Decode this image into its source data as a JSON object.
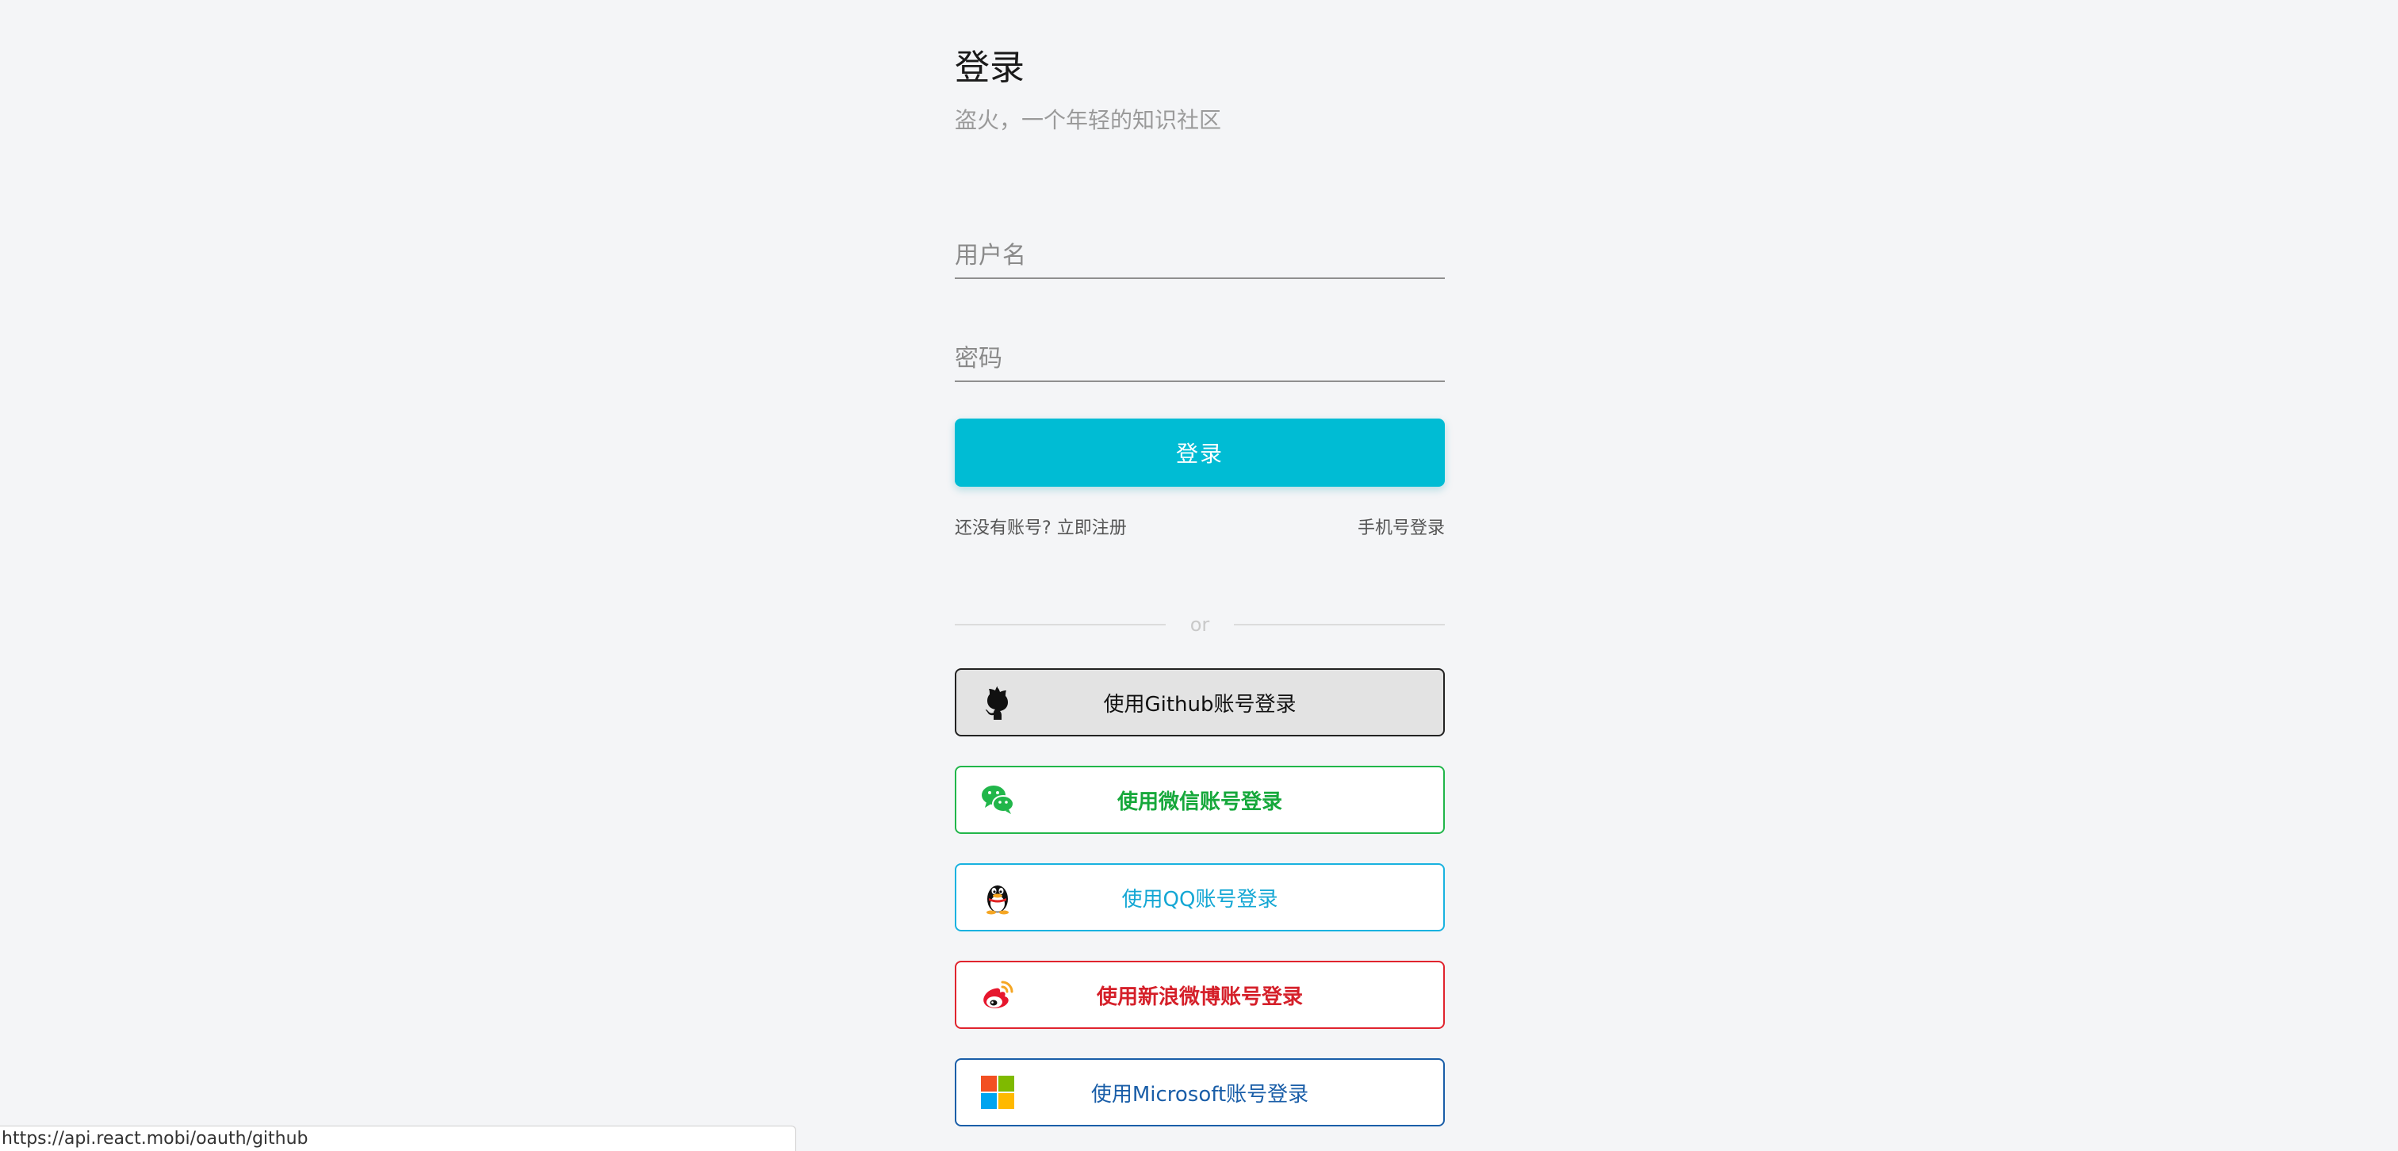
{
  "header": {
    "title": "登录",
    "subtitle": "盗火，一个年轻的知识社区"
  },
  "form": {
    "username_placeholder": "用户名",
    "password_placeholder": "密码",
    "submit_label": "登录"
  },
  "links": {
    "no_account": "还没有账号?",
    "register": "立即注册",
    "phone_login": "手机号登录"
  },
  "divider": {
    "text": "or"
  },
  "social": {
    "github": {
      "label": "使用Github账号登录",
      "icon": "github-icon",
      "color": "#222222"
    },
    "wechat": {
      "label": "使用微信账号登录",
      "icon": "wechat-icon",
      "color": "#16a83b"
    },
    "qq": {
      "label": "使用QQ账号登录",
      "icon": "qq-icon",
      "color": "#14a7d4"
    },
    "weibo": {
      "label": "使用新浪微博账号登录",
      "icon": "weibo-icon",
      "color": "#d5202a"
    },
    "microsoft": {
      "label": "使用Microsoft账号登录",
      "icon": "microsoft-icon",
      "color": "#1a5ea8"
    }
  },
  "status_bar": {
    "url": "https://api.react.mobi/oauth/github"
  },
  "colors": {
    "accent": "#00bcd4",
    "background": "#f4f5f7"
  }
}
